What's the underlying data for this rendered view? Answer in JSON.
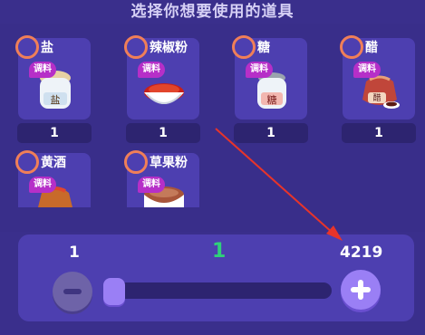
{
  "header": {
    "title": "选择你想要使用的道具"
  },
  "items": [
    {
      "name": "盐",
      "tag": "调料",
      "count": "1",
      "icon": "salt-jar-icon",
      "jar_label": "盐"
    },
    {
      "name": "辣椒粉",
      "tag": "调料",
      "count": "1",
      "icon": "chili-powder-bowl-icon"
    },
    {
      "name": "糖",
      "tag": "调料",
      "count": "1",
      "icon": "sugar-jar-icon",
      "jar_label": "糖"
    },
    {
      "name": "醋",
      "tag": "调料",
      "count": "1",
      "icon": "vinegar-jar-icon",
      "jar_label": "醋"
    },
    {
      "name": "黄酒",
      "tag": "调料",
      "icon": "rice-wine-jar-icon"
    },
    {
      "name": "草果粉",
      "tag": "调料",
      "icon": "tsaoko-powder-bowl-icon"
    }
  ],
  "quantity": {
    "min": "1",
    "max": "4219",
    "current": "1",
    "level": 0.0
  },
  "colors": {
    "background": "#3a2f8c",
    "card": "#4d3fb0",
    "select_ring": "#f07f58",
    "tag": "#b62fc8",
    "current_value": "#2fd07a",
    "arrow": "#e8342a"
  }
}
